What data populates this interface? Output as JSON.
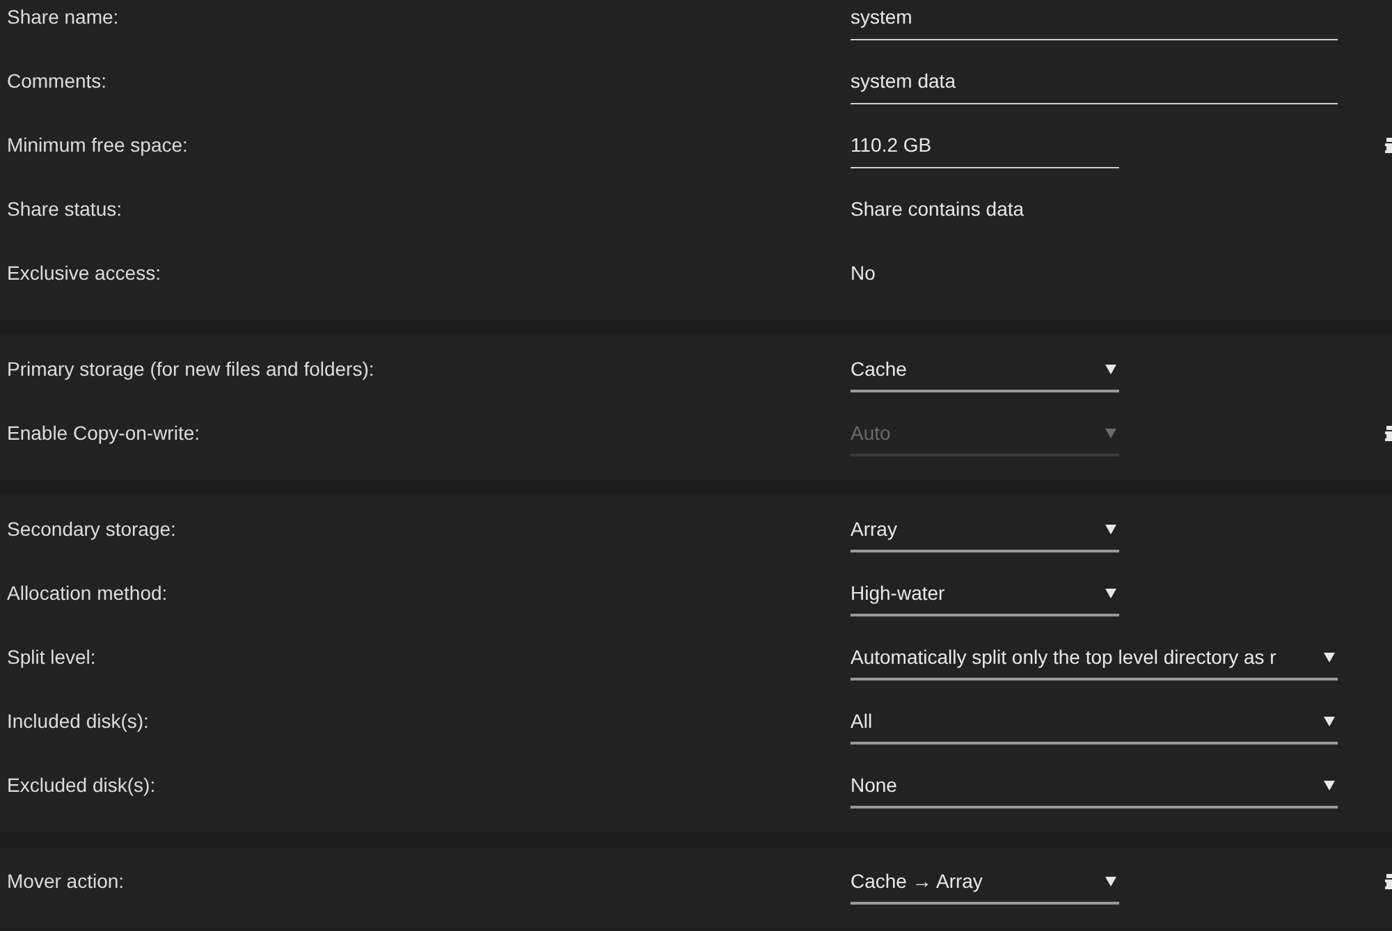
{
  "sections": [
    {
      "rows": [
        {
          "label": "Share name:",
          "kind": "text_input",
          "value": "system",
          "disabled": false,
          "info": false
        },
        {
          "label": "Comments:",
          "kind": "text_input",
          "value": "system data",
          "disabled": false,
          "info": false
        },
        {
          "label": "Minimum free space:",
          "kind": "size_input",
          "value": "110.2 GB",
          "disabled": false,
          "info": true
        },
        {
          "label": "Share status:",
          "kind": "static",
          "value": "Share contains data",
          "disabled": false,
          "info": false
        },
        {
          "label": "Exclusive access:",
          "kind": "static",
          "value": "No",
          "disabled": false,
          "info": false
        }
      ]
    },
    {
      "rows": [
        {
          "label": "Primary storage (for new files and folders):",
          "kind": "dropdown",
          "value": "Cache",
          "disabled": false,
          "info": false
        },
        {
          "label": "Enable Copy-on-write:",
          "kind": "dropdown",
          "value": "Auto",
          "disabled": true,
          "info": true
        }
      ]
    },
    {
      "rows": [
        {
          "label": "Secondary storage:",
          "kind": "dropdown",
          "value": "Array",
          "disabled": false,
          "info": false
        },
        {
          "label": "Allocation method:",
          "kind": "dropdown",
          "value": "High-water",
          "disabled": false,
          "info": false
        },
        {
          "label": "Split level:",
          "kind": "dropdown_wide",
          "value": "Automatically split only the top level directory as r",
          "disabled": false,
          "info": false
        },
        {
          "label": "Included disk(s):",
          "kind": "dropdown_wide",
          "value": "All",
          "disabled": false,
          "info": false
        },
        {
          "label": "Excluded disk(s):",
          "kind": "dropdown_wide",
          "value": "None",
          "disabled": false,
          "info": false
        }
      ]
    },
    {
      "rows": [
        {
          "label": "Mover action:",
          "kind": "dropdown",
          "value": "Cache → Array",
          "disabled": false,
          "info": true
        }
      ]
    }
  ]
}
